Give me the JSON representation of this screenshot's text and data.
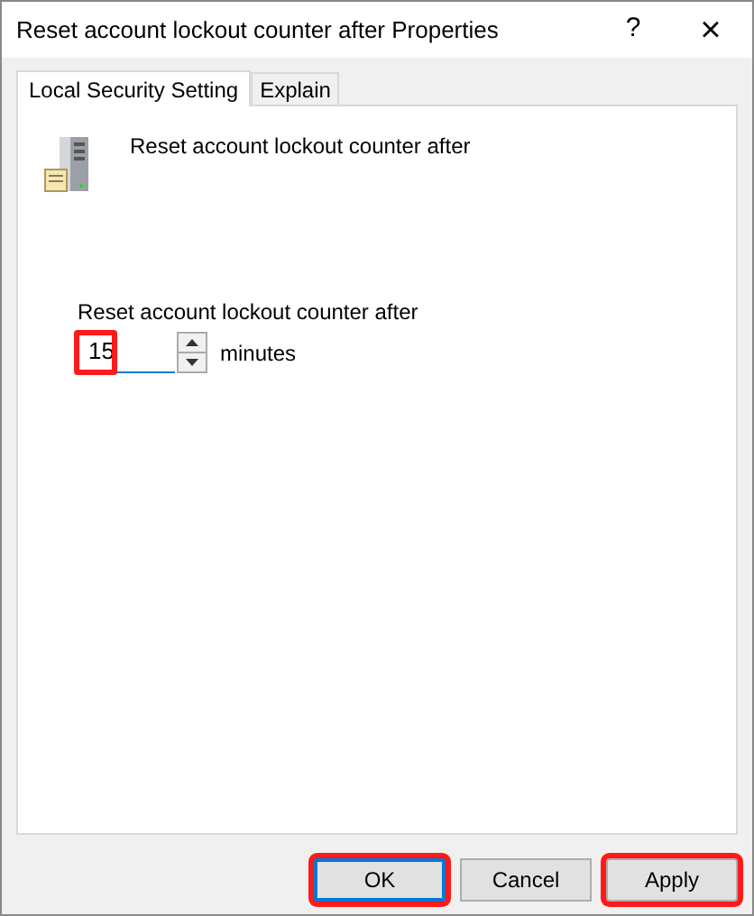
{
  "window": {
    "title": "Reset account lockout counter after Properties",
    "help": "?",
    "close": "×"
  },
  "tabs": [
    {
      "label": "Local Security Setting",
      "selected": true
    },
    {
      "label": "Explain",
      "selected": false
    }
  ],
  "policy": {
    "name": "Reset account lockout counter after"
  },
  "setting": {
    "label": "Reset account lockout counter after",
    "value": "15",
    "unit": "minutes",
    "highlighted": true
  },
  "buttons": [
    {
      "label": "OK",
      "default": true,
      "highlighted": true
    },
    {
      "label": "Cancel",
      "default": false,
      "highlighted": false
    },
    {
      "label": "Apply",
      "default": false,
      "highlighted": true
    }
  ]
}
